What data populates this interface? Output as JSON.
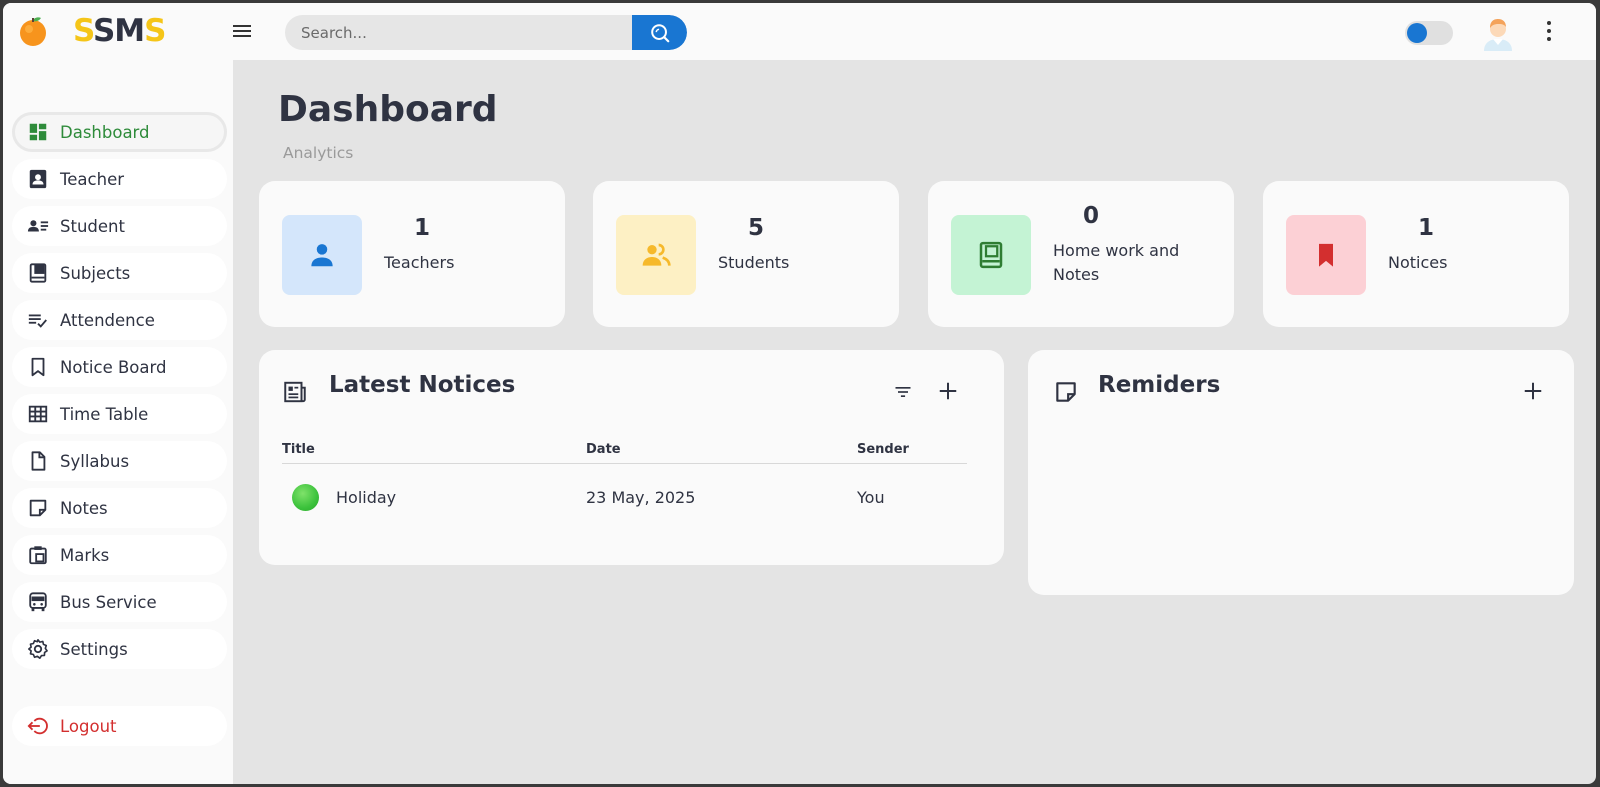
{
  "brand": {
    "name_first": "S",
    "name_mid": "SM",
    "name_last": "S"
  },
  "search": {
    "placeholder": "Search..."
  },
  "sidebar": {
    "items": [
      {
        "label": "Dashboard"
      },
      {
        "label": "Teacher"
      },
      {
        "label": "Student"
      },
      {
        "label": "Subjects"
      },
      {
        "label": "Attendence"
      },
      {
        "label": "Notice Board"
      },
      {
        "label": "Time Table"
      },
      {
        "label": "Syllabus"
      },
      {
        "label": "Notes"
      },
      {
        "label": "Marks"
      },
      {
        "label": "Bus Service"
      },
      {
        "label": "Settings"
      }
    ],
    "logout": "Logout"
  },
  "page": {
    "title": "Dashboard",
    "subtitle": "Analytics"
  },
  "stats": [
    {
      "value": "1",
      "label": "Teachers",
      "color": "#1976d2",
      "bg": "#d4e6fb"
    },
    {
      "value": "5",
      "label": "Students",
      "color": "#f6c343",
      "bg": "#fdf0c4"
    },
    {
      "value": "0",
      "label": "Home work and Notes",
      "color": "#2e7d32",
      "bg": "#c4f3d4"
    },
    {
      "value": "1",
      "label": "Notices",
      "color": "#d32f2f",
      "bg": "#fcd0d5"
    }
  ],
  "notices": {
    "title": "Latest Notices",
    "columns": [
      "Title",
      "Date",
      "Sender"
    ],
    "rows": [
      {
        "title": "Holiday",
        "date": "23 May, 2025",
        "sender": "You"
      }
    ]
  },
  "reminders": {
    "title": "Remiders"
  },
  "colors": {
    "accent": "#1976d2",
    "active": "#2e8b3a",
    "danger": "#d32f2f"
  }
}
